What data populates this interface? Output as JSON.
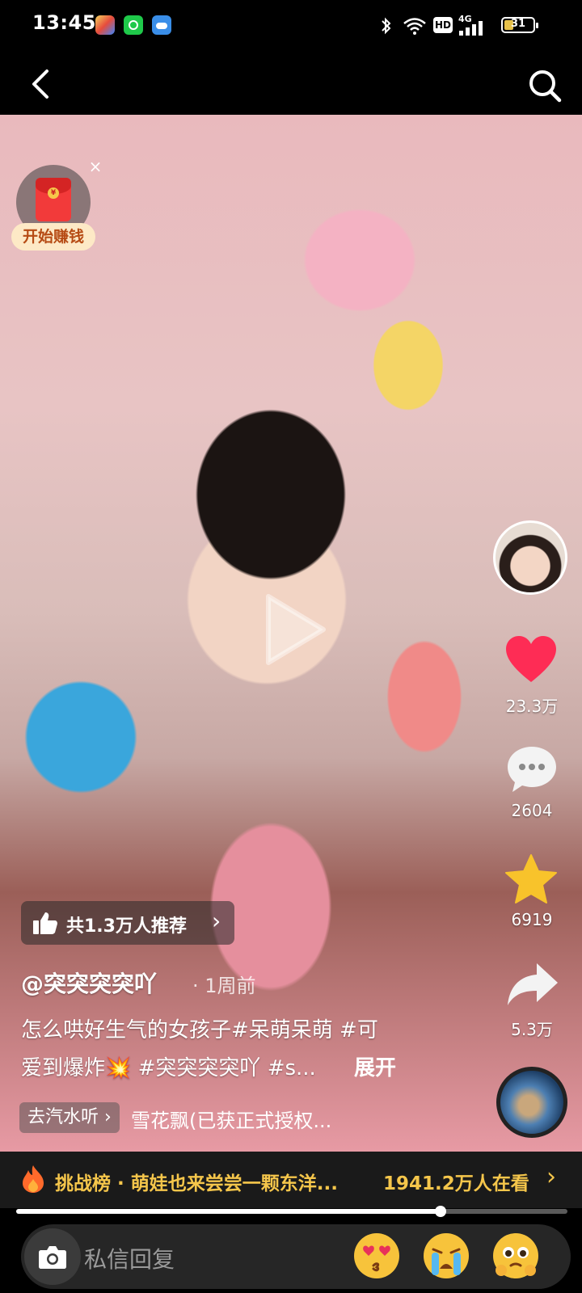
{
  "status_bar": {
    "time": "13:45",
    "network": "4G",
    "hd": "HD",
    "battery": "31",
    "battery_level": 0.31
  },
  "nav": {
    "back_icon": "chevron-left-icon",
    "search_icon": "search-icon"
  },
  "red_envelope": {
    "label": "开始赚钱",
    "close": "×",
    "icon": "red-envelope-icon"
  },
  "side_actions": {
    "likes": "23.3万",
    "comments": "2604",
    "favorites": "6919",
    "shares": "5.3万"
  },
  "recommend": {
    "text": "共1.3万人推荐",
    "arrow": "›"
  },
  "post": {
    "author": "@突突突突吖",
    "time_ago": "· 1周前",
    "description_line1": "怎么哄好生气的女孩子#呆萌呆萌 #可",
    "description_line2": "爱到爆炸💥 #突突突突吖 #s...",
    "expand": "展开"
  },
  "music": {
    "pill": "去汽水听 ›",
    "title": "雪花飘(已获正式授权..."
  },
  "challenge_bar": {
    "text": "挑战榜 · 萌娃也来尝尝一颗东洋...",
    "viewers": "1941.2万人在看",
    "arrow": "›"
  },
  "playback": {
    "progress": 0.77
  },
  "message_bar": {
    "placeholder": "私信回复",
    "emojis": [
      "😘",
      "😭",
      "🥹"
    ]
  },
  "colors": {
    "accent_gold": "#f5c64b",
    "like_red": "#fe2c55",
    "favorite_yellow": "#f8c32b"
  }
}
